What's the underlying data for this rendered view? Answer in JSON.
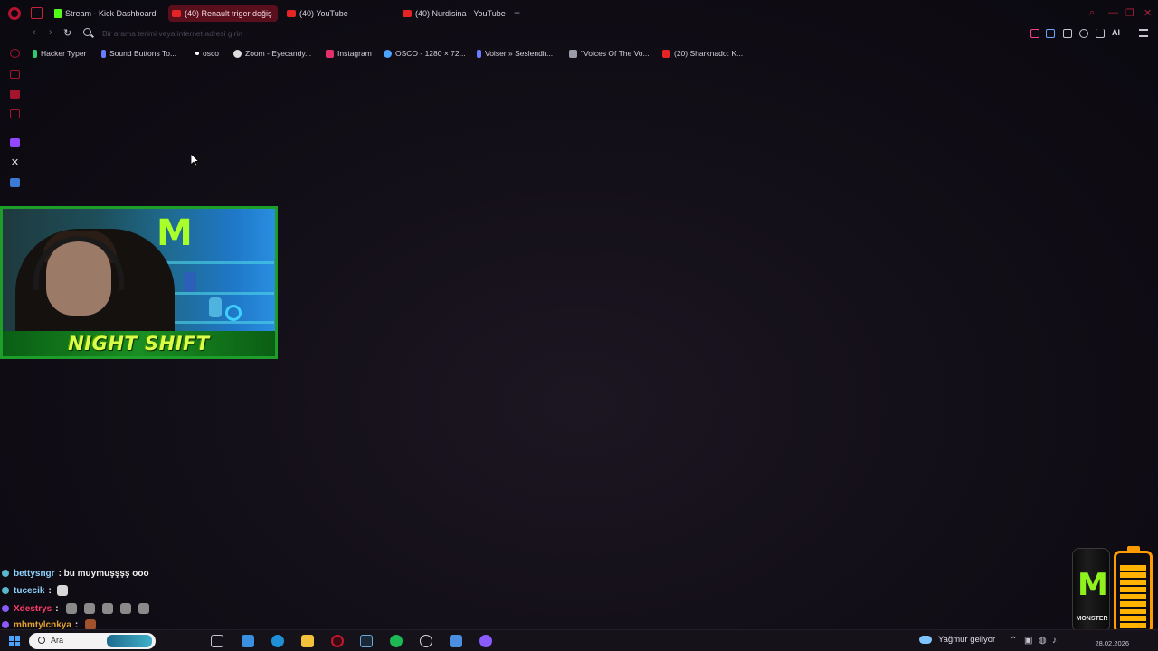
{
  "browser": {
    "tabs": [
      {
        "label": "Stream - Kick Dashboard",
        "icon": "kick-icon",
        "active": false
      },
      {
        "label": "(40) Renault triger değiş",
        "icon": "youtube-icon",
        "active": true
      },
      {
        "label": "(40) YouTube",
        "icon": "youtube-icon",
        "active": false
      },
      {
        "label": "(40) Nurdisina - YouTube",
        "icon": "youtube-icon",
        "active": false
      }
    ],
    "new_tab_label": "+",
    "address_placeholder": "Bir arama terimi veya internet adresi girin",
    "ai_label": "AI"
  },
  "bookmarks": [
    {
      "label": "Hacker Typer",
      "icon": "terminal-icon",
      "color": "#2ecc71"
    },
    {
      "label": "Sound Buttons To...",
      "icon": "bars-icon",
      "color": "#6a7cff"
    },
    {
      "label": "osco",
      "icon": "dot-icon",
      "color": "#ffffff"
    },
    {
      "label": "Zoom - Eyecandy...",
      "icon": "globe-icon",
      "color": "#dddddd"
    },
    {
      "label": "Instagram",
      "icon": "instagram-icon",
      "color": "#e1306c"
    },
    {
      "label": "OSCO - 1280 × 72...",
      "icon": "globe-icon",
      "color": "#4aa3ff"
    },
    {
      "label": "Voiser » Seslendir...",
      "icon": "bars-icon",
      "color": "#6a7cff"
    },
    {
      "label": "\"Voices Of The Vo...",
      "icon": "image-icon",
      "color": "#9a9aa8"
    },
    {
      "label": "(20) Sharknado: K...",
      "icon": "youtube-icon",
      "color": "#e52525"
    }
  ],
  "overlay": {
    "banner_text": "NIGHT SHIFT"
  },
  "chat": [
    {
      "user": "bettysngr",
      "message": "bu muymuşşşş ooo",
      "color": "#8fd3ff",
      "emotes": 0
    },
    {
      "user": "tucecik",
      "message": "",
      "color": "#8fd3ff",
      "emotes": 1
    },
    {
      "user": "Xdestrys",
      "message": "",
      "color": "#ff3b6b",
      "emotes": 5
    },
    {
      "user": "mhmtylcnkya",
      "message": "",
      "color": "#e0a030",
      "emotes": 1
    }
  ],
  "can_overlay": {
    "brand": "MONSTER",
    "battery_level": 0.85
  },
  "taskbar": {
    "search_text": "Ara",
    "weather": "Yağmur geliyor",
    "clock_date": "28.02.2026"
  },
  "colors": {
    "accent": "#b2142f",
    "kick_green": "#53fc18",
    "banner_green": "#1f9d2a"
  }
}
